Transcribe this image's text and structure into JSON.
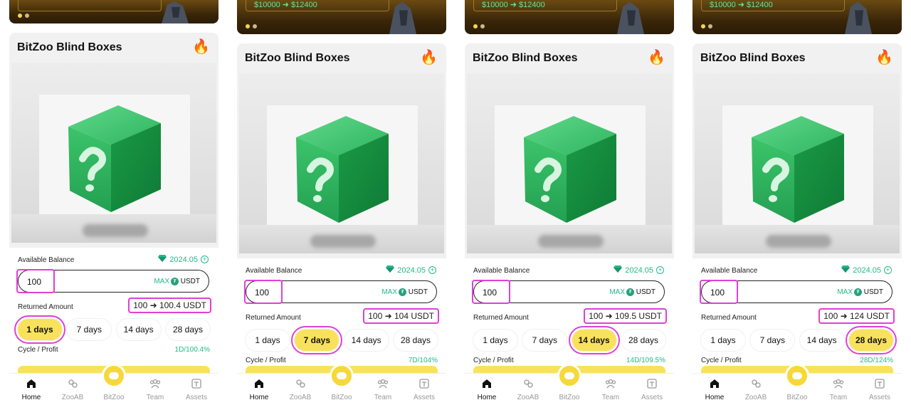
{
  "screens": [
    {
      "banner": {
        "text": ""
      },
      "title": "BitZoo Blind Boxes",
      "balance_label": "Available Balance",
      "balance_value": "2024.05",
      "input_value": "100",
      "max_label": "MAX",
      "unit": "USDT",
      "returned_label": "Returned Amount",
      "returned_value": "100 ➜ 100.4  USDT",
      "days": [
        "1 days",
        "7 days",
        "14 days",
        "28 days"
      ],
      "selected_day": 0,
      "cycle_label": "Cycle / Profit",
      "cycle_value": "1D/100.4%"
    },
    {
      "banner": {
        "text": "$10000 ➜ $12400"
      },
      "title": "BitZoo Blind Boxes",
      "balance_label": "Available Balance",
      "balance_value": "2024.05",
      "input_value": "100",
      "max_label": "MAX",
      "unit": "USDT",
      "returned_label": "Returned Amount",
      "returned_value": "100 ➜ 104  USDT",
      "days": [
        "1 days",
        "7 days",
        "14 days",
        "28 days"
      ],
      "selected_day": 1,
      "cycle_label": "Cycle / Profit",
      "cycle_value": "7D/104%"
    },
    {
      "banner": {
        "text": "$10000 ➜ $12400"
      },
      "title": "BitZoo Blind Boxes",
      "balance_label": "Available Balance",
      "balance_value": "2024.05",
      "input_value": "100",
      "max_label": "MAX",
      "unit": "USDT",
      "returned_label": "Returned Amount",
      "returned_value": "100 ➜ 109.5  USDT",
      "days": [
        "1 days",
        "7 days",
        "14 days",
        "28 days"
      ],
      "selected_day": 2,
      "cycle_label": "Cycle / Profit",
      "cycle_value": "14D/109.5%"
    },
    {
      "banner": {
        "text": "$10000 ➜ $12400"
      },
      "title": "BitZoo Blind Boxes",
      "balance_label": "Available Balance",
      "balance_value": "2024.05",
      "input_value": "100",
      "max_label": "MAX",
      "unit": "USDT",
      "returned_label": "Returned Amount",
      "returned_value": "100 ➜ 124  USDT",
      "days": [
        "1 days",
        "7 days",
        "14 days",
        "28 days"
      ],
      "selected_day": 3,
      "cycle_label": "Cycle / Profit",
      "cycle_value": "28D/124%"
    }
  ],
  "nav": [
    "Home",
    "ZooAB",
    "BitZoo",
    "Team",
    "Assets"
  ],
  "fire_icon": "🔥",
  "colors": {
    "accent_yellow": "#f9e25b",
    "accent_green": "#23b98a",
    "highlight": "#e040d8"
  }
}
